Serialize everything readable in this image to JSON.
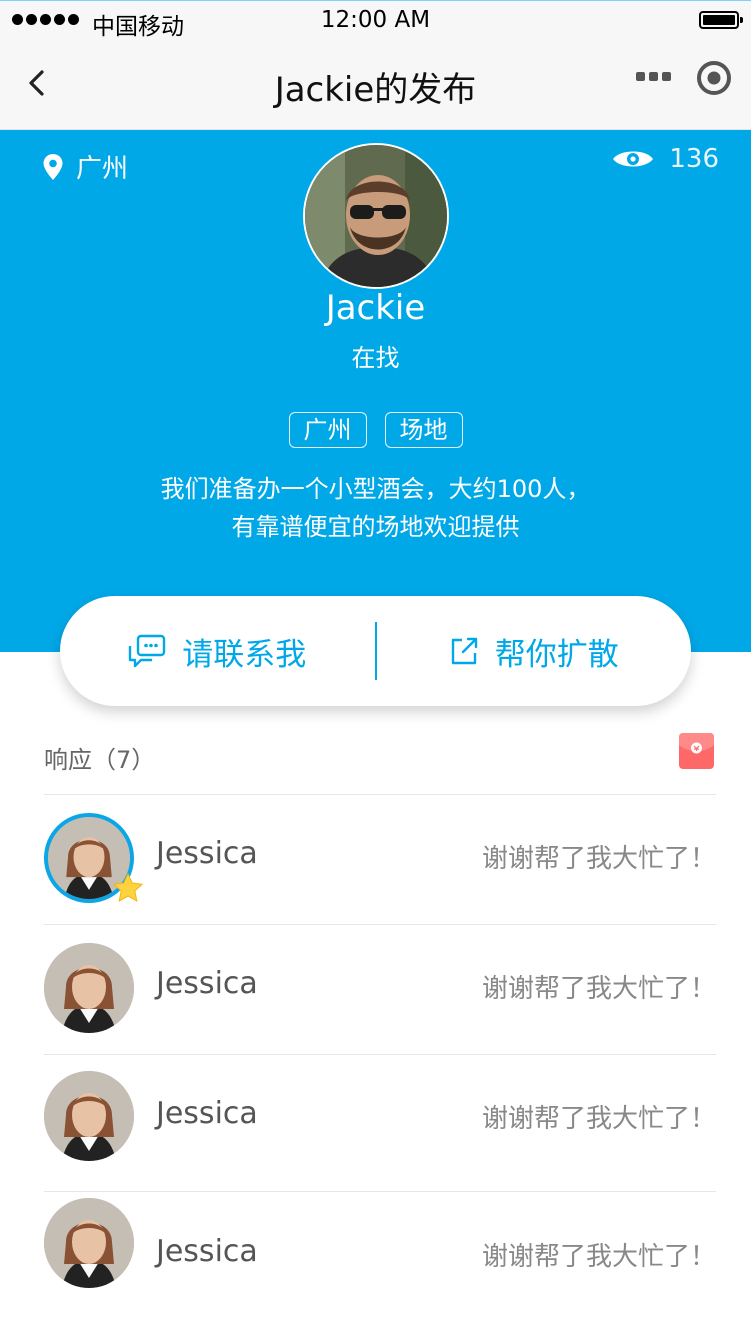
{
  "status_bar": {
    "carrier": "中国移动",
    "time": "12:00 AM"
  },
  "nav": {
    "title": "Jackie的发布",
    "back_icon": "chevron-left-icon",
    "more_icon": "more-dots-icon",
    "target_icon": "target-icon"
  },
  "profile": {
    "location": "广州",
    "views": "136",
    "name": "Jackie",
    "status": "在找",
    "tags": [
      "广州",
      "场地"
    ],
    "description_line1": "我们准备办一个小型酒会，大约100人，",
    "description_line2": "有靠谱便宜的场地欢迎提供"
  },
  "actions": {
    "contact": "请联系我",
    "share": "帮你扩散"
  },
  "responses": {
    "title": "响应（7）",
    "items": [
      {
        "name": "Jessica",
        "message": "谢谢帮了我大忙了！",
        "highlight": true
      },
      {
        "name": "Jessica",
        "message": "谢谢帮了我大忙了！",
        "highlight": false
      },
      {
        "name": "Jessica",
        "message": "谢谢帮了我大忙了！",
        "highlight": false
      },
      {
        "name": "Jessica",
        "message": "谢谢帮了我大忙了！",
        "highlight": false
      }
    ]
  },
  "colors": {
    "accent": "#00a8e8",
    "red_packet": "#ff6868",
    "star": "#ffd23f"
  }
}
